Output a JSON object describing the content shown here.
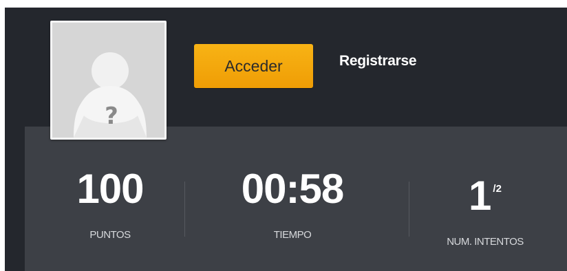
{
  "header": {
    "login_button": "Acceder",
    "register_link": "Registrarse"
  },
  "avatar": {
    "icon": "placeholder-user-icon",
    "glyph": "?"
  },
  "stats": [
    {
      "value": "100",
      "label": "PUNTOS"
    },
    {
      "value": "00:58",
      "label": "TIEMPO"
    },
    {
      "value": "1",
      "suffix": "/2",
      "label": "NUM. INTENTOS"
    }
  ],
  "colors": {
    "background": "#24272d",
    "stats_background": "#3d4046",
    "accent": "#f5a80c",
    "text": "#ffffff"
  }
}
